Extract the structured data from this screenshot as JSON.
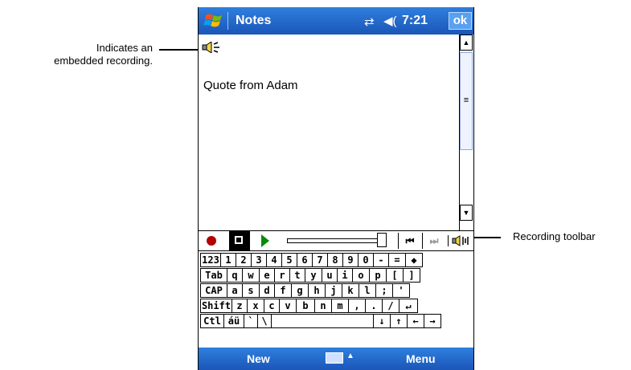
{
  "callouts": {
    "embedded_line1": "Indicates an",
    "embedded_line2": "embedded recording.",
    "toolbar": "Recording toolbar"
  },
  "titlebar": {
    "title": "Notes",
    "time": "7:21",
    "ok_label": "ok",
    "connectivity_glyph": "⇄",
    "volume_glyph": "◀("
  },
  "note": {
    "text": "Quote from Adam"
  },
  "scrollbar": {
    "up": "▲",
    "down": "▼",
    "thumb": "≡"
  },
  "recording_toolbar": {
    "prev_label": "⏮",
    "next_label": "⏭"
  },
  "keyboard": {
    "row1": [
      "123",
      "1",
      "2",
      "3",
      "4",
      "5",
      "6",
      "7",
      "8",
      "9",
      "0",
      "-",
      "=",
      "◆"
    ],
    "row2": [
      "Tab",
      "q",
      "w",
      "e",
      "r",
      "t",
      "y",
      "u",
      "i",
      "o",
      "p",
      "[",
      "]"
    ],
    "row3": [
      "CAP",
      "a",
      "s",
      "d",
      "f",
      "g",
      "h",
      "j",
      "k",
      "l",
      ";",
      "'"
    ],
    "row4": [
      "Shift",
      "z",
      "x",
      "c",
      "v",
      "b",
      "n",
      "m",
      ",",
      ".",
      "/",
      "↵"
    ],
    "row5": [
      "Ctl",
      "áü",
      "`",
      "\\",
      "",
      "↓",
      "↑",
      "←",
      "→"
    ]
  },
  "menubar": {
    "left": "New",
    "right": "Menu",
    "arrow": "▲"
  },
  "colors": {
    "titlebar": "#1f66cc",
    "record": "#b30000",
    "play": "#0a8a0a"
  }
}
